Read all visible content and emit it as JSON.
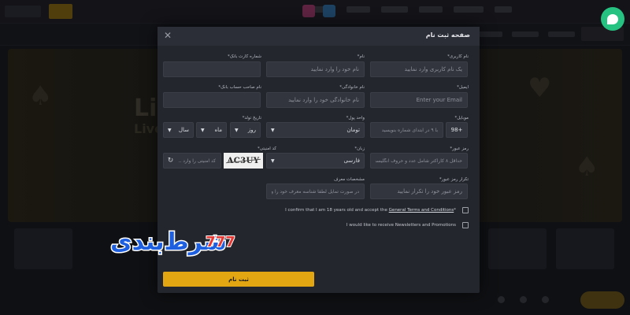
{
  "modal": {
    "title": "صفحه ثبت نام",
    "close_icon": "close-icon"
  },
  "form": {
    "username": {
      "label": "نام کاربری*",
      "placeholder": "یک نام کاربری وارد نمایید"
    },
    "first_name": {
      "label": "نام*",
      "placeholder": "نام خود را وارد نمایید"
    },
    "card_number": {
      "label": "شماره کارت بانک*",
      "placeholder": ""
    },
    "email": {
      "label": "ایمیل*",
      "placeholder": "Enter your Email"
    },
    "last_name": {
      "label": "نام خانوادگی*",
      "placeholder": "نام خانوادگی خود را وارد نمایید"
    },
    "account_holder": {
      "label": "نام صاحب حساب بانک*",
      "placeholder": ""
    },
    "mobile": {
      "label": "موبایل*",
      "code": "98+",
      "placeholder": "با ۹ در ابتدای شماره بنویسید"
    },
    "currency": {
      "label": "واحد پول*",
      "value": "تومان"
    },
    "birth_date": {
      "label": "تاریخ تولد*",
      "day": "روز",
      "month": "ماه",
      "year": "سال"
    },
    "password": {
      "label": "رمز عبور*",
      "placeholder": "حداقل ۸ کاراکتر شامل عدد و حروف انگلیسی"
    },
    "language": {
      "label": "زبان*",
      "value": "فارسی"
    },
    "captcha": {
      "label": "کد امنیتی*",
      "image_text": "AC3UY",
      "placeholder": "کد امنیتی را وارد ..."
    },
    "password_confirm": {
      "label": "تکرار رمز عبور*",
      "placeholder": "رمز عبور خود را تکرار نمایید"
    },
    "referrer": {
      "label": "مشخصات معرف",
      "placeholder": "در صورت تمایل لطفا شناسه معرف خود را وار"
    },
    "terms": {
      "text_prefix": "I confirm that I am 18 years old and accept the ",
      "link": "General Terms and Conditions",
      "text_suffix": "*"
    },
    "newsletter": {
      "text": "I would like to receive Newsletters and Promotions"
    },
    "submit_label": "ثبت نام"
  },
  "watermark": {
    "text": "شرط‌بندی",
    "number": "777"
  },
  "background": {
    "banner_text": "Live",
    "banner_sub": "Live c"
  },
  "colors": {
    "accent": "#e3a613",
    "chat": "#26c281",
    "modal_bg": "#24262e"
  }
}
